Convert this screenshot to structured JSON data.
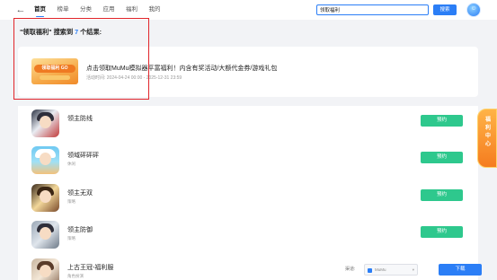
{
  "nav": {
    "back_icon": "arrow-left-icon",
    "items": [
      {
        "label": "首页",
        "active": true
      },
      {
        "label": "榜单",
        "active": false
      },
      {
        "label": "分类",
        "active": false
      },
      {
        "label": "应用",
        "active": false
      },
      {
        "label": "福利",
        "active": false
      },
      {
        "label": "我的",
        "active": false
      }
    ]
  },
  "search": {
    "value": "领取福利",
    "button_label": "搜索"
  },
  "result": {
    "prefix": "\"领取福利\" 搜索到 ",
    "count": "7",
    "suffix": " 个结果:"
  },
  "promo": {
    "image_text": "领取福利 GO",
    "title": "点击领取MuMu模拟器平富福利！内含有奖活动/大额代金券/游戏礼包",
    "time": "活动时间: 2024-04-24 00:00 - 2025-12-31 23:59"
  },
  "games": [
    {
      "name": "领主防线",
      "tag": "",
      "action": "预约"
    },
    {
      "name": "领域砰砰砰",
      "tag": "休闲",
      "action": "预约"
    },
    {
      "name": "领主无双",
      "tag": "策略",
      "action": "预约"
    },
    {
      "name": "领主防御",
      "tag": "策略",
      "action": "预约"
    },
    {
      "name": "上古王冠-福利服",
      "tag": "角色扮演",
      "action": "下载",
      "channel_label": "渠道:",
      "channel_value": "MuMu"
    }
  ],
  "welfare_badge": "福利中心",
  "colors": {
    "accent_blue": "#2b7ef6",
    "reserve_green": "#2ec88d",
    "highlight_red": "#e1252b",
    "welfare_orange": "#f57c1f"
  }
}
